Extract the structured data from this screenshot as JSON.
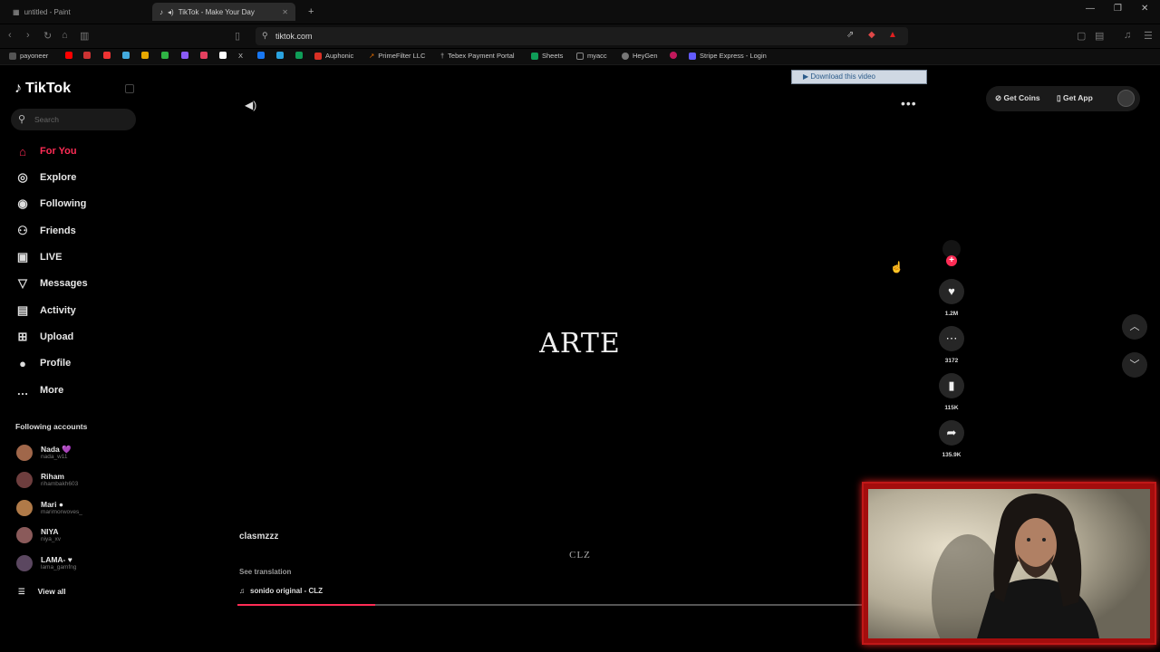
{
  "browser": {
    "tabs": [
      {
        "title": "untitled - Paint",
        "active": false
      },
      {
        "title": "TikTok - Make Your Day",
        "active": true
      }
    ],
    "new_tab": "+",
    "url": "tiktok.com",
    "download_button": "Download this video",
    "download_extra": "▶ 2"
  },
  "bookmarks": [
    {
      "label": "payoneer",
      "color": "#888"
    },
    {
      "label": "",
      "color": "#ff0000"
    },
    {
      "label": "",
      "color": "#e6a800"
    },
    {
      "label": "",
      "color": "#2fb344"
    },
    {
      "label": "",
      "color": "#8b5cf6"
    },
    {
      "label": "",
      "color": "#e4405f"
    },
    {
      "label": "",
      "color": "#ffffff"
    },
    {
      "label": "X",
      "color": "#000"
    },
    {
      "label": "",
      "color": "#1877f2"
    },
    {
      "label": "",
      "color": "#2aa3e0"
    },
    {
      "label": "",
      "color": "#0f9d58"
    },
    {
      "label": "Auphonic",
      "color": "#d93025"
    },
    {
      "label": "PrimeFilter LLC",
      "color": "#e06c00"
    },
    {
      "label": "Tebex Payment Portal",
      "color": "#bbb"
    },
    {
      "label": "Sheets",
      "color": "#0f9d58"
    },
    {
      "label": "myacc",
      "color": "#888"
    },
    {
      "label": "HeyGen",
      "color": "#888"
    },
    {
      "label": "",
      "color": "#c2185b"
    },
    {
      "label": "Stripe Express - Login",
      "color": "#635bff"
    }
  ],
  "sidebar": {
    "logo": "TikTok",
    "search_placeholder": "Search",
    "nav": [
      {
        "label": "For You",
        "icon": "home-icon",
        "glyph": "⌂",
        "active": true
      },
      {
        "label": "Explore",
        "icon": "compass-icon",
        "glyph": "◎",
        "active": false
      },
      {
        "label": "Following",
        "icon": "following-avatar-icon",
        "glyph": "◉",
        "active": false
      },
      {
        "label": "Friends",
        "icon": "friends-icon",
        "glyph": "⚇",
        "active": false
      },
      {
        "label": "LIVE",
        "icon": "live-icon",
        "glyph": "▣",
        "active": false
      },
      {
        "label": "Messages",
        "icon": "messages-icon",
        "glyph": "▽",
        "active": false
      },
      {
        "label": "Activity",
        "icon": "activity-icon",
        "glyph": "▤",
        "active": false
      },
      {
        "label": "Upload",
        "icon": "upload-icon",
        "glyph": "⊞",
        "active": false
      },
      {
        "label": "Profile",
        "icon": "profile-icon",
        "glyph": "●",
        "active": false
      },
      {
        "label": "More",
        "icon": "more-icon",
        "glyph": "…",
        "active": false
      }
    ],
    "following_title": "Following accounts",
    "accounts": [
      {
        "name": "Nada 💜",
        "handle": "nada_w11",
        "color": "#a0674a"
      },
      {
        "name": "Riham",
        "handle": "rihambakh603",
        "color": "#6e3e3e"
      },
      {
        "name": "Mari ●",
        "handle": "marimorwoves_",
        "color": "#b07a48"
      },
      {
        "name": "NIYA",
        "handle": "niya_xv",
        "color": "#8a5a5a"
      },
      {
        "name": "LAMA- ♥",
        "handle": "lama_gamfng",
        "color": "#5b4760"
      }
    ],
    "view_all": "View all"
  },
  "topright": {
    "get_coins": "Get Coins",
    "get_app": "Get App"
  },
  "video": {
    "overlay_title": "ARTE",
    "watermark": "CLZ",
    "author": "clasmzzz",
    "see_translation": "See translation",
    "sound": "sonido original - CLZ",
    "progress_fraction": 0.22
  },
  "actions": {
    "likes": "1.2M",
    "comments": "3172",
    "saves": "115K",
    "shares": "135.9K"
  },
  "colors": {
    "accent": "#fe2c55",
    "background": "#000000"
  }
}
